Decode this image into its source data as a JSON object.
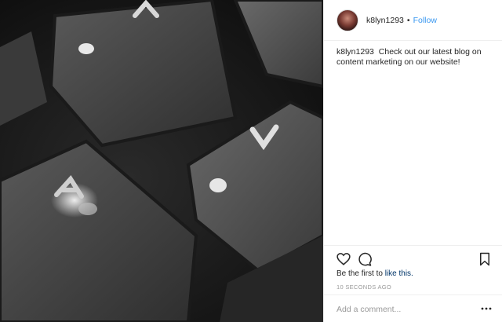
{
  "post": {
    "photo_alt": "",
    "author": {
      "username": "k8lyn1293",
      "separator": "•",
      "follow_label": "Follow"
    },
    "caption": {
      "username": "k8lyn1293",
      "text": "Check out our latest blog on content marketing on our website!"
    },
    "actions": {
      "like_icon": "heart-icon",
      "comment_icon": "comment-icon",
      "save_icon": "bookmark-icon"
    },
    "likes": {
      "prefix": "Be the first to",
      "link": "like this."
    },
    "timestamp": "10 SECONDS AGO",
    "comment": {
      "placeholder": "Add a comment...",
      "more_icon": "more-options-icon"
    }
  },
  "colors": {
    "link_blue": "#3897f0",
    "dark_link": "#003569",
    "muted": "#999999",
    "border": "#efefef"
  }
}
